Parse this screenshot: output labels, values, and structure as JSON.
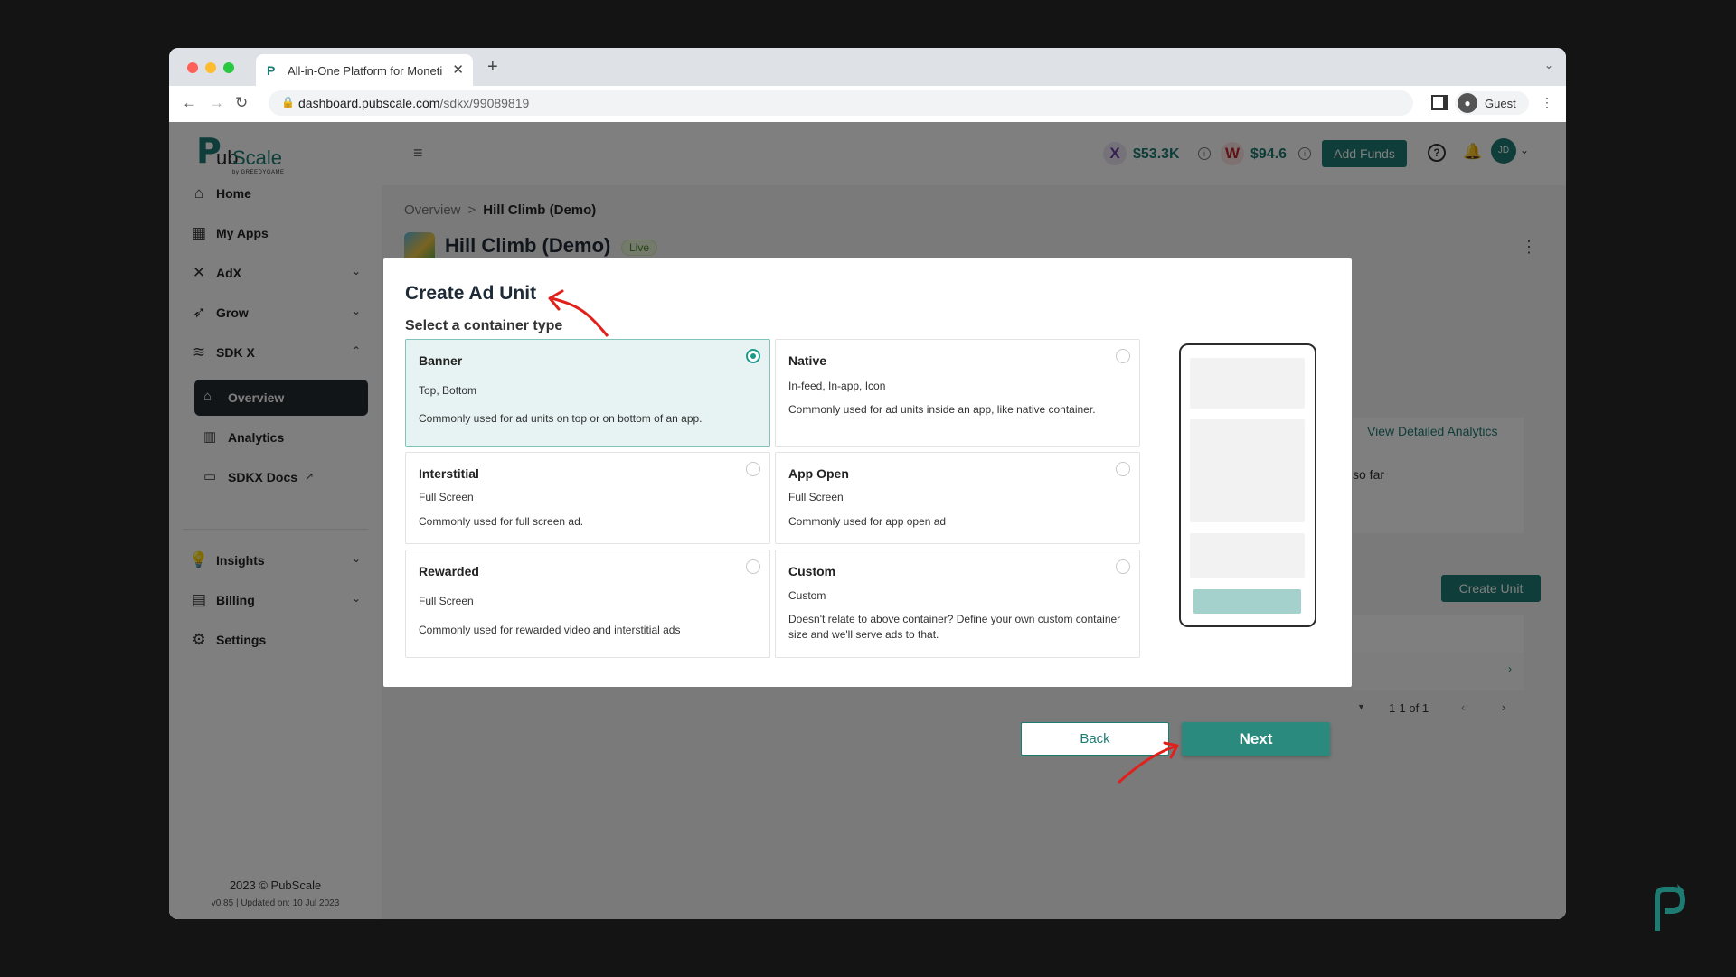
{
  "browser": {
    "tab_title": "All-in-One Platform for Moneti",
    "tab_favicon": "P",
    "url_host": "dashboard.pubscale.com",
    "url_path": "/sdkx/99089819",
    "profile_label": "Guest"
  },
  "sidebar": {
    "logo_mark": "P",
    "logo_text_1": "ub",
    "logo_text_2": "Scale",
    "logo_tagline": "by GREEDYGAME",
    "items": [
      {
        "label": "Home",
        "icon": "home-icon"
      },
      {
        "label": "My Apps",
        "icon": "grid-icon"
      },
      {
        "label": "AdX",
        "icon": "adx-icon"
      },
      {
        "label": "Grow",
        "icon": "rocket-icon"
      },
      {
        "label": "SDK X",
        "icon": "layers-icon"
      }
    ],
    "sdkx_children": [
      {
        "label": "Overview",
        "icon": "home-icon"
      },
      {
        "label": "Analytics",
        "icon": "chart-icon"
      },
      {
        "label": "SDKX Docs",
        "icon": "terminal-icon"
      }
    ],
    "lower_items": [
      {
        "label": "Insights",
        "icon": "bulb-icon"
      },
      {
        "label": "Billing",
        "icon": "billing-icon"
      },
      {
        "label": "Settings",
        "icon": "gear-icon"
      }
    ],
    "footer_copyright": "2023 © PubScale",
    "footer_version": "v0.85 | Updated on: 10 Jul 2023"
  },
  "topbar": {
    "wallet_x_badge": "X",
    "wallet_x_amount": "$53.3K",
    "wallet_w_badge": "W",
    "wallet_w_amount": "$94.6",
    "add_funds_label": "Add Funds",
    "user_initials": "JD"
  },
  "page": {
    "breadcrumb_root": "Overview",
    "breadcrumb_sep": ">",
    "breadcrumb_current": "Hill Climb (Demo)",
    "app_title": "Hill Climb (Demo)",
    "status_badge": "Live",
    "view_analytics_label": "View Detailed Analytics",
    "so_far_text": "so far",
    "create_unit_label": "Create Unit",
    "pagination_text": "1-1 of 1"
  },
  "modal": {
    "title": "Create Ad Unit",
    "subtitle": "Select a container type",
    "cards": [
      {
        "title": "Banner",
        "sub": "Top, Bottom",
        "desc": "Commonly used for ad units on top or on bottom of an app."
      },
      {
        "title": "Native",
        "sub": "In-feed, In-app, Icon",
        "desc": "Commonly used for ad units inside an app, like native container."
      },
      {
        "title": "Interstitial",
        "sub": "Full Screen",
        "desc": "Commonly used for full screen ad."
      },
      {
        "title": "App Open",
        "sub": "Full Screen",
        "desc": "Commonly used for app open ad"
      },
      {
        "title": "Rewarded",
        "sub": "Full Screen",
        "desc": "Commonly used for rewarded video and interstitial ads"
      },
      {
        "title": "Custom",
        "sub": "Custom",
        "desc": "Doesn't relate to above container? Define your own custom container size and we'll serve ads to that."
      }
    ],
    "selected_card": "Banner",
    "back_label": "Back",
    "next_label": "Next"
  },
  "colors": {
    "brand": "#1e7b72",
    "selected_card_bg": "#e7f3f2",
    "sidebar_active_bg": "#252a31",
    "annotation_arrow": "#e0211b"
  }
}
